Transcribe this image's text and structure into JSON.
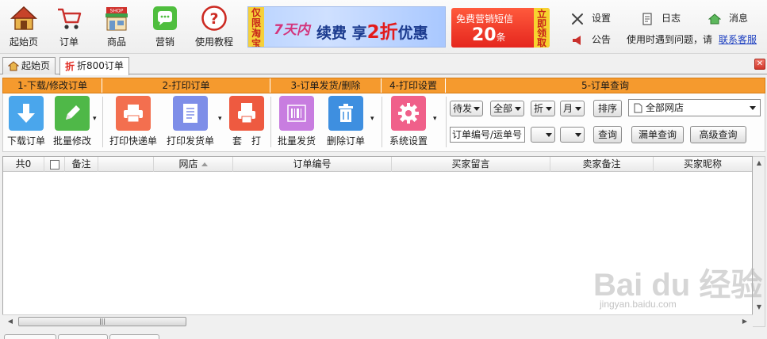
{
  "nav": {
    "home": "起始页",
    "order": "订单",
    "goods": "商品",
    "marketing": "营销",
    "tutorial": "使用教程",
    "shop_badge": "SHOP"
  },
  "banner1": {
    "tag": "仅限淘宝",
    "days": "7天内",
    "pre": "续费 享",
    "num": "2折",
    "post": "优惠"
  },
  "banner2": {
    "line1": "免费营销短信",
    "count": "20",
    "unit": "条",
    "action": "立即领取"
  },
  "toplinks": {
    "settings": "设置",
    "log": "日志",
    "message": "消息",
    "notice": "公告",
    "problem": "使用时遇到问题，请",
    "contact": "联系客服"
  },
  "tabs": {
    "home": "起始页",
    "order800": "折800订单",
    "zhe_icon": "折"
  },
  "sections": {
    "s1": "1-下载/修改订单",
    "s2": "2-打印订单",
    "s3": "3-订单发货/删除",
    "s4": "4-打印设置",
    "s5": "5-订单查询"
  },
  "toolbar": {
    "download": "下载订单",
    "batch_modify": "批量修改",
    "print_express": "打印快递单",
    "print_invoice": "打印发货单",
    "set_print": "套　打",
    "batch_ship": "批量发货",
    "delete_order": "删除订单",
    "system_settings": "系统设置"
  },
  "query": {
    "sel_status": "待发",
    "sel_all": "全部",
    "sel_3": "折",
    "sel_4": "月",
    "sort": "排序",
    "shop": "全部网店",
    "input": "订单编号/运单号",
    "sel_5": "",
    "sel_6": "",
    "query": "查询",
    "missing_query": "漏单查询",
    "advanced_query": "高级查询"
  },
  "grid": {
    "count": "共0",
    "remark": "备注",
    "shop": "网店",
    "order_no": "订单编号",
    "buyer_msg": "买家留言",
    "seller_remark": "卖家备注",
    "buyer_nick": "买家昵称"
  },
  "watermark": {
    "brand": "Bai du 经验",
    "url": "jingyan.baidu.com"
  },
  "colors": {
    "section_bar": "#f59a2e",
    "download_btn": "#4aa6ec",
    "modify_btn": "#4fb848",
    "print_btn": "#f36f4f",
    "invoice_btn": "#7e8ee8",
    "setprint_btn": "#ee5a40",
    "ship_btn": "#c87de0",
    "delete_btn": "#3e8fe0",
    "sys_btn": "#f0608a",
    "link": "#1a3dc0"
  }
}
